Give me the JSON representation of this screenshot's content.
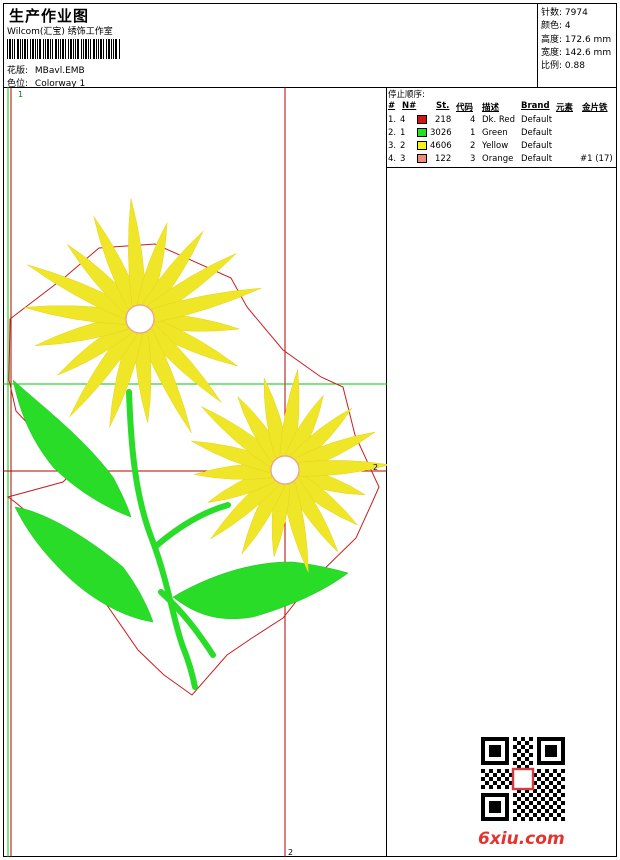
{
  "header": {
    "title": "生产作业图",
    "subtitle": "Wilcom(汇宝) 绣饰工作室",
    "design_label": "花版:",
    "design_value": "MBavl.EMB",
    "colorway_label": "色位:",
    "colorway_value": "Colorway 1"
  },
  "stats": [
    {
      "label": "针数:",
      "value": "7974"
    },
    {
      "label": "颜色:",
      "value": "4"
    },
    {
      "label": "高度:",
      "value": "172.6 mm"
    },
    {
      "label": "宽度:",
      "value": "142.6 mm"
    },
    {
      "label": "比例:",
      "value": "0.88"
    }
  ],
  "stop_sequence": {
    "title": "停止顺序:",
    "headers": {
      "idx": "#",
      "n": "N#",
      "st": "St.",
      "code": "代码",
      "desc": "描述",
      "brand": "Brand",
      "element": "元素",
      "sequins": "金片铁"
    },
    "rows": [
      {
        "idx": "1.",
        "n": "4",
        "color": "#d21414",
        "st": "218",
        "code": "4",
        "desc": "Dk. Red",
        "brand": "Default",
        "sequins": ""
      },
      {
        "idx": "2.",
        "n": "1",
        "color": "#1ee61e",
        "st": "3026",
        "code": "1",
        "desc": "Green",
        "brand": "Default",
        "sequins": ""
      },
      {
        "idx": "3.",
        "n": "2",
        "color": "#f5f514",
        "st": "4606",
        "code": "2",
        "desc": "Yellow",
        "brand": "Default",
        "sequins": ""
      },
      {
        "idx": "4.",
        "n": "3",
        "color": "#f08c78",
        "st": "122",
        "code": "3",
        "desc": "Orange",
        "brand": "Default",
        "sequins": "#1 (17)"
      }
    ]
  },
  "guides": {
    "top_marker": "1",
    "right_marker": "2",
    "bottom_marker": "2"
  },
  "watermark": "6xiu.com",
  "colors": {
    "outline": "#c81e1e",
    "guide_red": "#b40000",
    "guide_green": "#00c800",
    "petal": "#f0e628",
    "leaf": "#28dc28"
  }
}
